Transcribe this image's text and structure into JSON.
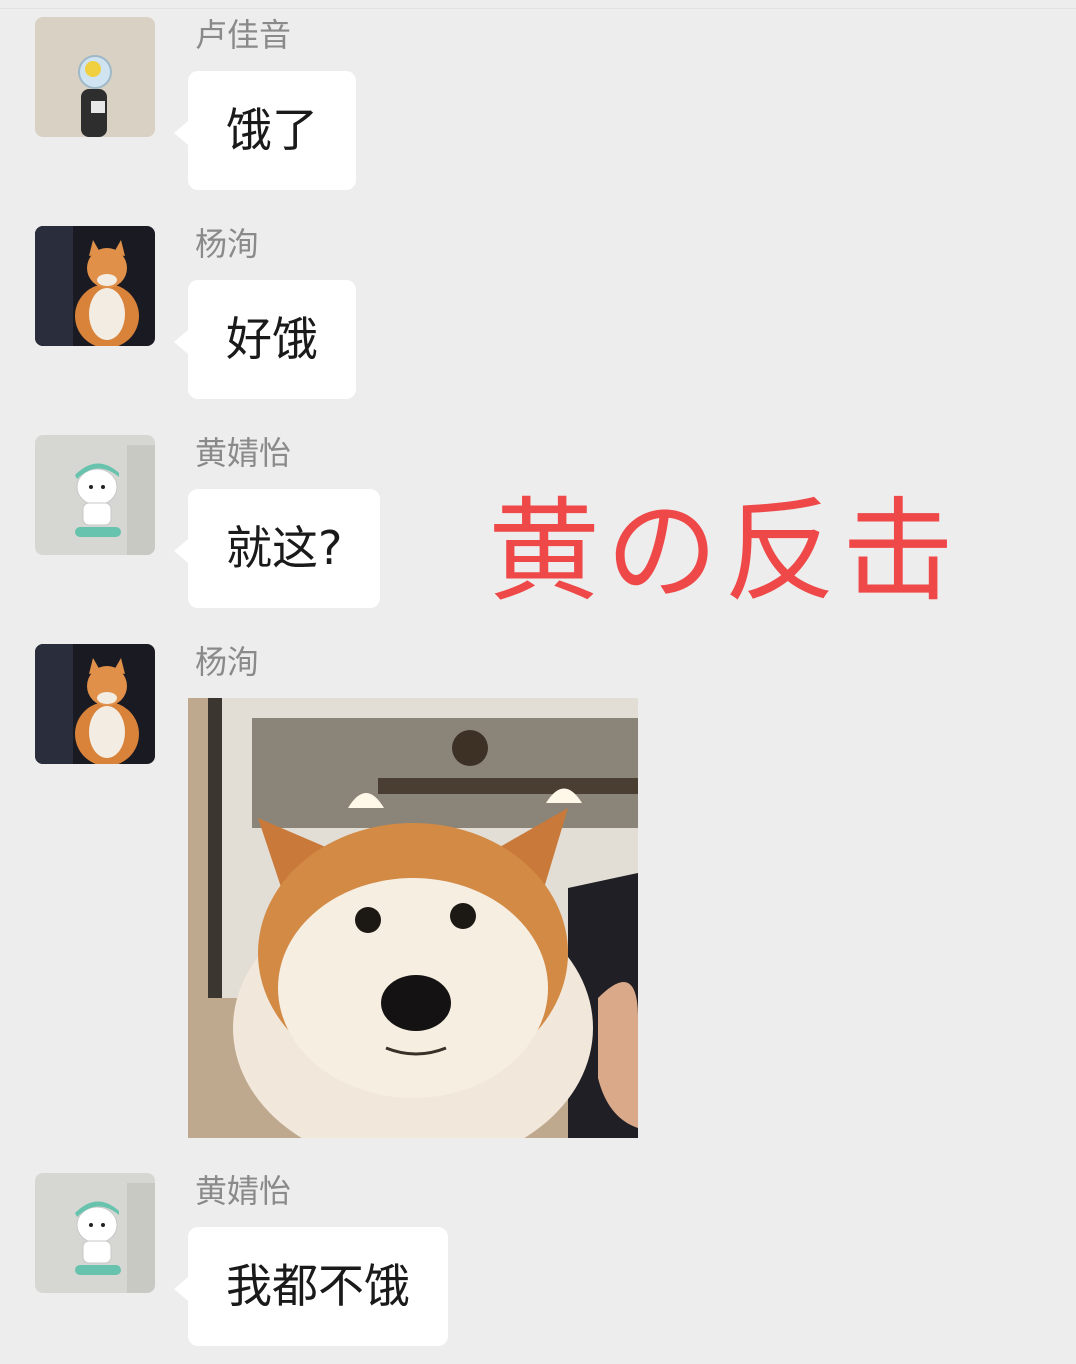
{
  "messages": [
    {
      "sender": "卢佳音",
      "text": "饿了",
      "avatar": "lu-avatar"
    },
    {
      "sender": "杨洵",
      "text": "好饿",
      "avatar": "cat-avatar"
    },
    {
      "sender": "黄婧怡",
      "text": "就这?",
      "avatar": "pochacco-avatar"
    },
    {
      "sender": "杨洵",
      "image": "shiba-dog-photo",
      "avatar": "cat-avatar"
    },
    {
      "sender": "黄婧怡",
      "text": "我都不饿",
      "avatar": "pochacco-avatar"
    }
  ],
  "overlay_caption": "黄の反击",
  "colors": {
    "background": "#ededed",
    "bubble": "#ffffff",
    "sender_text": "#8a8a8a",
    "overlay": "#ef4848"
  }
}
